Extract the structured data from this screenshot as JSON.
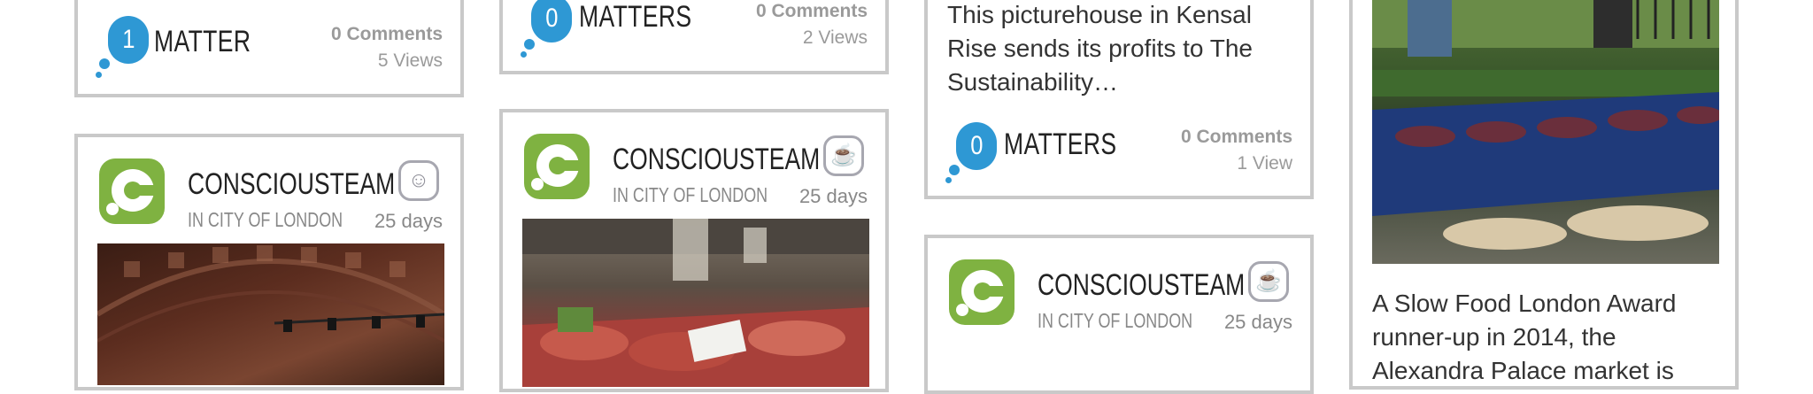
{
  "cards": {
    "c1_top": {
      "matters": {
        "count": "1",
        "label": "MATTER",
        "comments": "0 Comments",
        "views": "5 Views"
      }
    },
    "c2_top": {
      "matters": {
        "count": "0",
        "label": "MATTERS",
        "comments": "0 Comments",
        "views": "2 Views"
      }
    },
    "c3_top": {
      "description": "This picturehouse in Kensal Rise sends its profits to The Sustainability…",
      "matters": {
        "count": "0",
        "label": "MATTERS",
        "comments": "0 Comments",
        "views": "1 View"
      }
    },
    "c1_bottom": {
      "author": "CONSCIOUSTEAM",
      "location": "IN CITY OF LONDON",
      "age": "25 days",
      "category_icon": "theatre-masks-icon"
    },
    "c2_bottom": {
      "author": "CONSCIOUSTEAM",
      "location": "IN CITY OF LONDON",
      "age": "25 days",
      "category_icon": "coffee-cup-icon"
    },
    "c3_bottom": {
      "author": "CONSCIOUSTEAM",
      "location": "IN CITY OF LONDON",
      "age": "25 days",
      "category_icon": "coffee-cup-icon"
    },
    "c4": {
      "description": "A Slow Food London Award runner-up in 2014, the Alexandra Palace market is"
    }
  },
  "colors": {
    "brand_green": "#7fb241",
    "matters_blue": "#2e98d4",
    "border": "#c9c9c9"
  }
}
